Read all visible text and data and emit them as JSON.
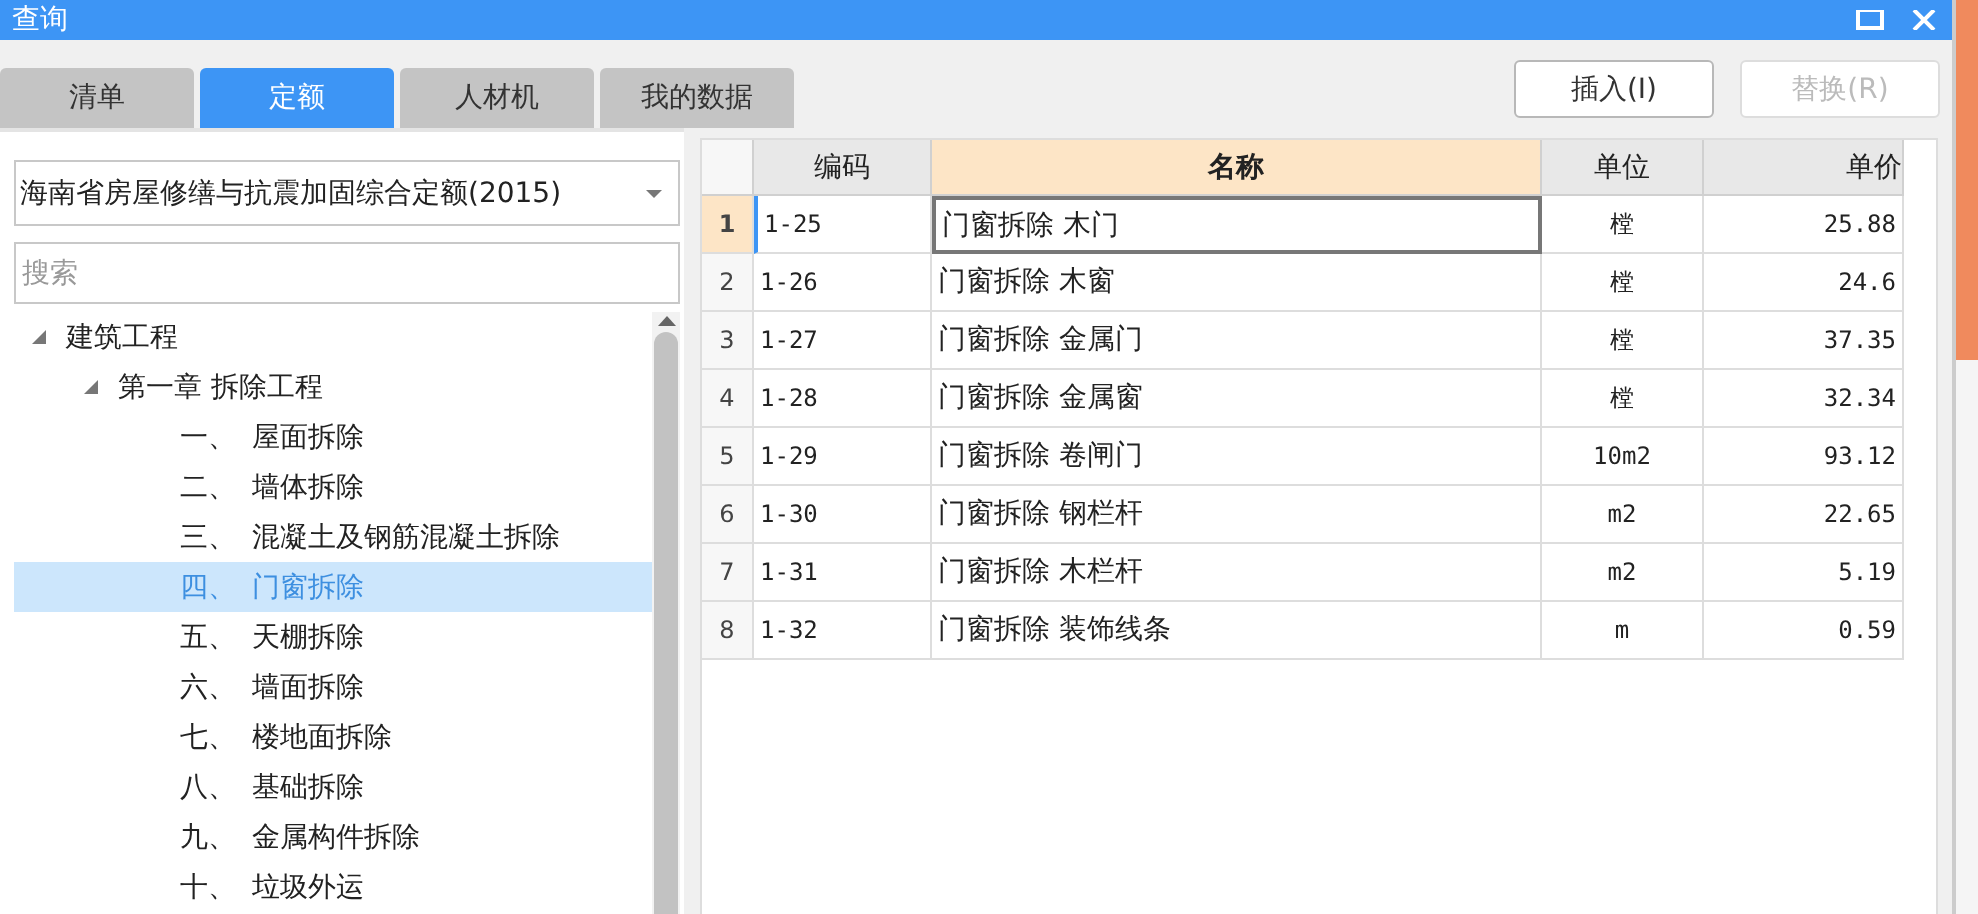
{
  "window": {
    "title": "查询"
  },
  "tabs": [
    {
      "label": "清单",
      "selected": false
    },
    {
      "label": "定额",
      "selected": true
    },
    {
      "label": "人材机",
      "selected": false
    },
    {
      "label": "我的数据",
      "selected": false
    }
  ],
  "buttons": [
    {
      "label": "插入(I)",
      "disabled": false
    },
    {
      "label": "替换(R)",
      "disabled": true
    }
  ],
  "library_select": {
    "value": "海南省房屋修缮与抗震加固综合定额(2015)"
  },
  "search": {
    "placeholder": "搜索"
  },
  "tree": [
    {
      "label": "建筑工程",
      "expanded": true,
      "selected": false,
      "children": [
        {
          "label": "第一章 拆除工程",
          "expanded": true,
          "selected": false,
          "children": [
            {
              "number": "一、",
              "label": "屋面拆除",
              "selected": false
            },
            {
              "number": "二、",
              "label": "墙体拆除",
              "selected": false
            },
            {
              "number": "三、",
              "label": "混凝土及钢筋混凝土拆除",
              "selected": false
            },
            {
              "number": "四、",
              "label": "门窗拆除",
              "selected": true
            },
            {
              "number": "五、",
              "label": "天棚拆除",
              "selected": false
            },
            {
              "number": "六、",
              "label": "墙面拆除",
              "selected": false
            },
            {
              "number": "七、",
              "label": "楼地面拆除",
              "selected": false
            },
            {
              "number": "八、",
              "label": "基础拆除",
              "selected": false
            },
            {
              "number": "九、",
              "label": "金属构件拆除",
              "selected": false
            },
            {
              "number": "十、",
              "label": "垃圾外运",
              "selected": false
            }
          ]
        }
      ]
    }
  ],
  "table": {
    "columns": [
      {
        "label": "编码",
        "selected": false
      },
      {
        "label": "名称",
        "selected": true
      },
      {
        "label": "单位",
        "selected": false
      },
      {
        "label": "单价",
        "selected": false
      }
    ],
    "rows": [
      {
        "index": "1",
        "code": "1-25",
        "name": "门窗拆除 木门",
        "unit": "樘",
        "price": "25.88",
        "selected": true
      },
      {
        "index": "2",
        "code": "1-26",
        "name": "门窗拆除 木窗",
        "unit": "樘",
        "price": "24.6",
        "selected": false
      },
      {
        "index": "3",
        "code": "1-27",
        "name": "门窗拆除 金属门",
        "unit": "樘",
        "price": "37.35",
        "selected": false
      },
      {
        "index": "4",
        "code": "1-28",
        "name": "门窗拆除 金属窗",
        "unit": "樘",
        "price": "32.34",
        "selected": false
      },
      {
        "index": "5",
        "code": "1-29",
        "name": "门窗拆除 卷闸门",
        "unit": "10m2",
        "price": "93.12",
        "selected": false
      },
      {
        "index": "6",
        "code": "1-30",
        "name": "门窗拆除 钢栏杆",
        "unit": "m2",
        "price": "22.65",
        "selected": false
      },
      {
        "index": "7",
        "code": "1-31",
        "name": "门窗拆除 木栏杆",
        "unit": "m2",
        "price": "5.19",
        "selected": false
      },
      {
        "index": "8",
        "code": "1-32",
        "name": "门窗拆除 装饰线条",
        "unit": "m",
        "price": "0.59",
        "selected": false
      }
    ]
  }
}
